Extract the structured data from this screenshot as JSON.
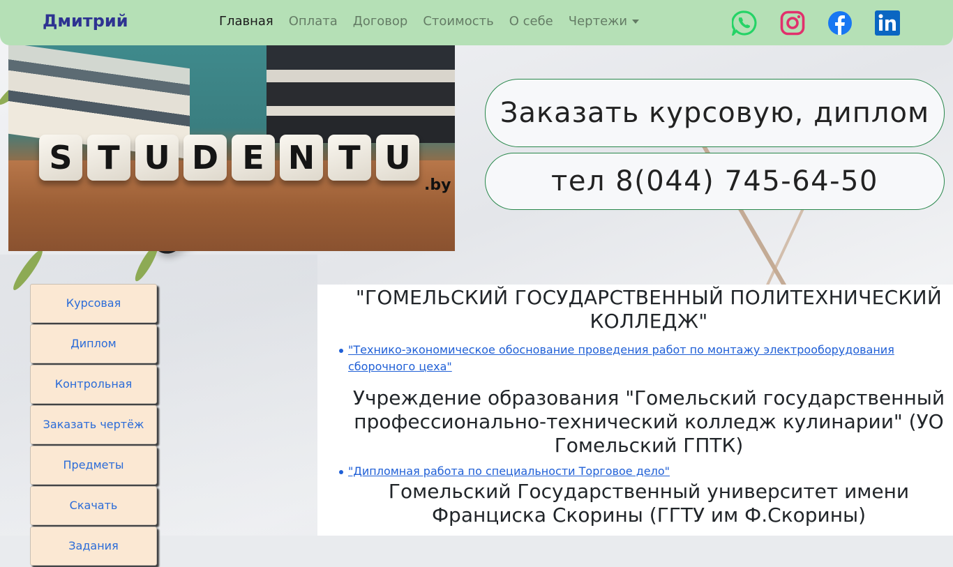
{
  "navbar": {
    "brand": "Дмитрий",
    "links": [
      {
        "label": "Главная",
        "active": true
      },
      {
        "label": "Оплата"
      },
      {
        "label": "Договор"
      },
      {
        "label": "Стоимость"
      },
      {
        "label": "О себе"
      },
      {
        "label": "Чертежи"
      }
    ],
    "social_icons": [
      "whatsapp-icon",
      "instagram-icon",
      "facebook-icon",
      "linkedin-icon"
    ],
    "colors": {
      "bar": "#b5e0b6",
      "brand": "#2e3391",
      "whatsapp": "#25d366",
      "instagram": "#e1306c",
      "facebook": "#1877f2",
      "linkedin": "#0a66c2"
    }
  },
  "hero": {
    "letters": [
      "S",
      "T",
      "U",
      "D",
      "E",
      "N",
      "T",
      "U"
    ],
    "suffix": ".by"
  },
  "cta": {
    "order_label": "Заказать курсовую, диплом",
    "phone_label": "тел 8(044) 745-64-50"
  },
  "sidebar": {
    "items": [
      {
        "label": "Курсовая"
      },
      {
        "label": "Диплом"
      },
      {
        "label": "Контрольная"
      },
      {
        "label": "Заказать чертёж"
      },
      {
        "label": "Предметы"
      },
      {
        "label": "Скачать"
      },
      {
        "label": "Задания"
      }
    ]
  },
  "content": {
    "heading1": "\"ГОМЕЛЬСКИЙ ГОСУДАРСТВЕННЫЙ ПОЛИТЕХНИЧЕСКИЙ КОЛЛЕДЖ\"",
    "link1": "\"Технико-экономическое обоснование проведения работ по монтажу электрооборудования сборочного цеха\"",
    "heading2": "Учреждение образования \"Гомельский государственный профессионально-технический колледж кулинарии\" (УО Гомельский ГПТК)",
    "link2": "\"Дипломная работа по специальности Торговое дело\"",
    "heading3": "Гомельский Государственный университет имени Франциска Скорины (ГГТУ им Ф.Скорины)"
  }
}
